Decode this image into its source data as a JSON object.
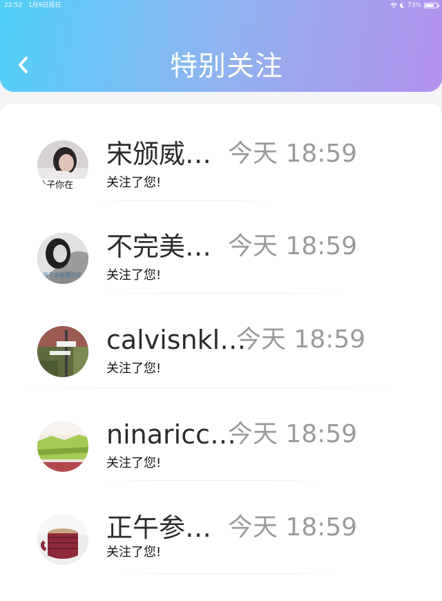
{
  "status_bar": {
    "time": "22:52",
    "date": "1月9日周日",
    "battery": "73%"
  },
  "header": {
    "title": "特别关注"
  },
  "items": [
    {
      "name": "宋颁威…",
      "time": "今天 18:59",
      "message": "关注了您!",
      "avatar_text": "孙子你在"
    },
    {
      "name": "不完美…",
      "time": "今天 18:59",
      "message": "关注了您!",
      "avatar_text": "孩子学会爱心灵"
    },
    {
      "name": "calvisnkl…",
      "time": "今天 18:59",
      "message": "关注了您!",
      "avatar_text": ""
    },
    {
      "name": "ninaricc…",
      "time": "今天 18:59",
      "message": "关注了您!",
      "avatar_text": ""
    },
    {
      "name": "正午参…",
      "time": "今天 18:59",
      "message": "关注了您!",
      "avatar_text": ""
    }
  ],
  "colors": {
    "header_gradient_start": "#4fd0f8",
    "header_gradient_end": "#b392ec",
    "name_text": "#2b2b2b",
    "time_text": "#9a9a9a"
  }
}
